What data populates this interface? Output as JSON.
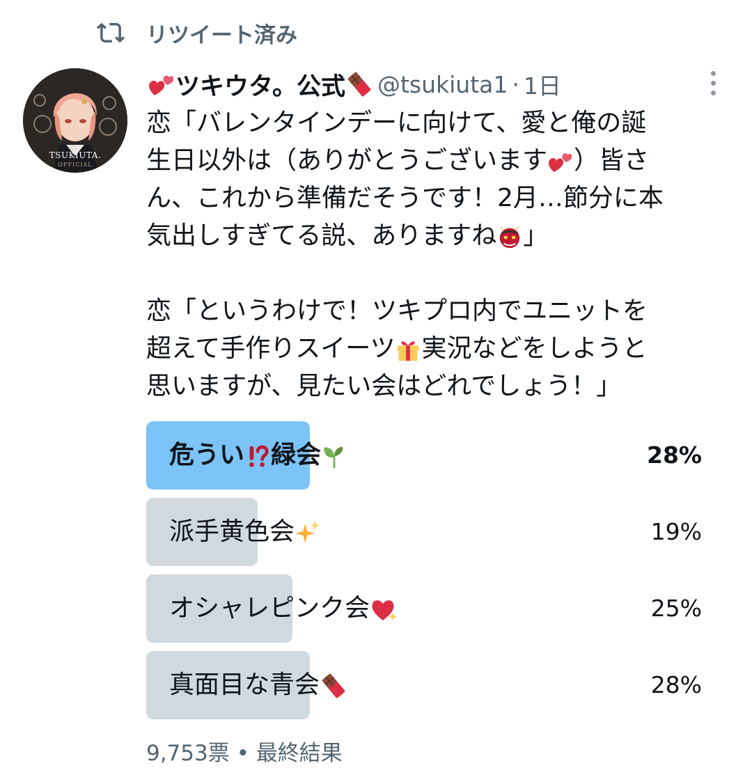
{
  "retweet": {
    "label": "リツイート済み",
    "icon": "retweet-icon"
  },
  "tweet": {
    "display_name": "ツキウタ。公式",
    "handle": "@tsukiuta1",
    "separator": "·",
    "time": "1日",
    "lines": [
      "恋「バレンタインデーに向けて、愛と俺の誕",
      "生日以外は（ありがとうございます",
      "）皆さ",
      "ん、これから準備だそうです！2月…節分に本",
      "気出しすぎてる説、ありますね",
      "」",
      "恋「というわけで！ツキプロ内でユニットを",
      "超えて手作りスイーツ",
      "実況などをしようと",
      "思いますが、見たい会はどれでしょう！」"
    ]
  },
  "avatar": {
    "brand": "TSUKIUTA.",
    "sub": "OFFICIAL"
  },
  "poll": {
    "options": [
      {
        "label": "危うい",
        "label_tail": "緑会",
        "percent": "28%",
        "value": 28,
        "winner": true
      },
      {
        "label": "派手黄色会",
        "percent": "19%",
        "value": 19,
        "winner": false
      },
      {
        "label": "オシャレピンク会",
        "percent": "25%",
        "value": 25,
        "winner": false
      },
      {
        "label": "真面目な青会",
        "percent": "28%",
        "value": 28,
        "winner": false
      }
    ],
    "footer": "9,753票 • 最終結果",
    "colors": {
      "winner_bar": "#7cc3f7",
      "bar": "#cfd9de",
      "muted_text": "#536471"
    }
  }
}
